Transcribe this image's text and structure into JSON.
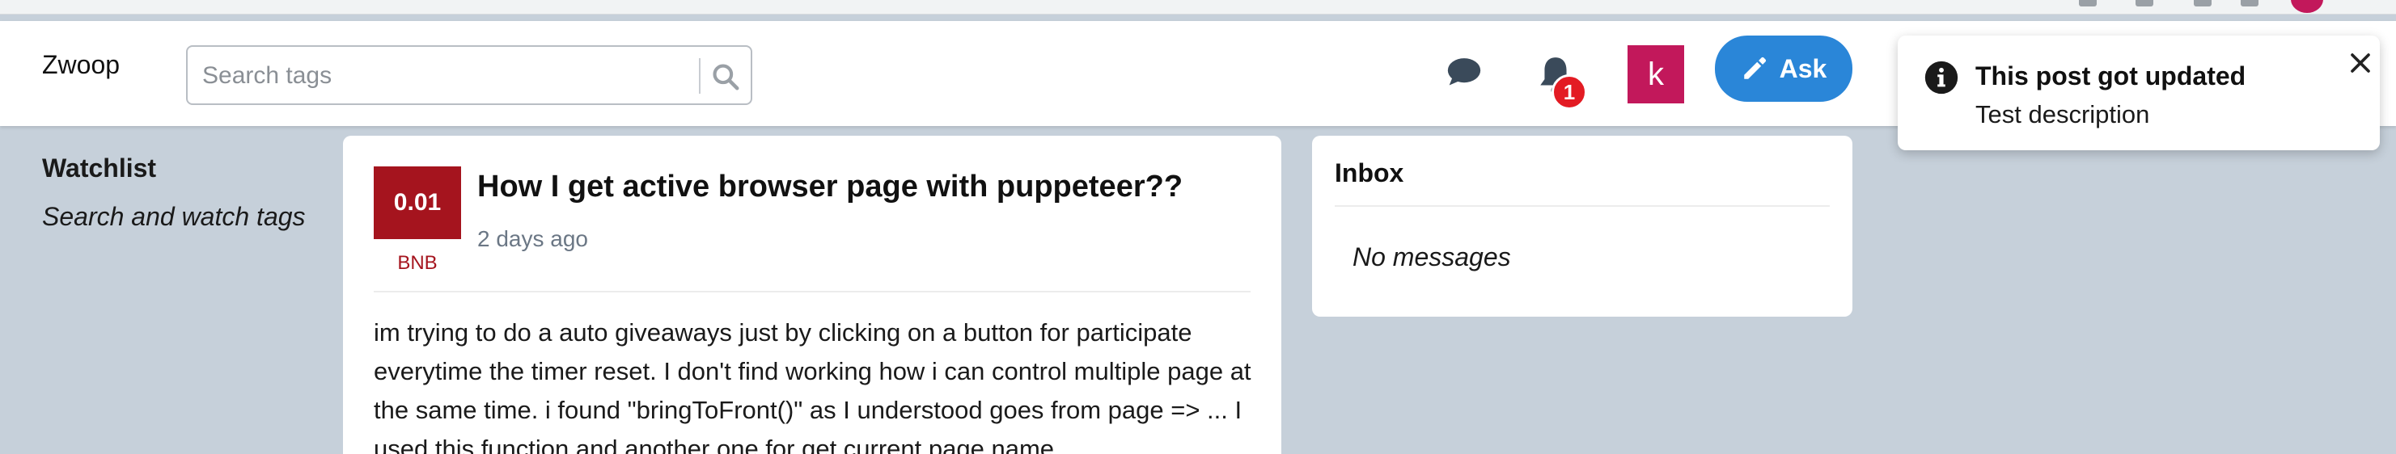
{
  "brand": {
    "name": "Zwoop"
  },
  "search": {
    "placeholder": "Search tags",
    "icon": "search-icon"
  },
  "header": {
    "chat_icon": "chat-bubble-icon",
    "notifications": {
      "icon": "bell-icon",
      "count": "1"
    },
    "avatar_letter": "k",
    "ask_button": {
      "label": "Ask",
      "icon": "pencil-icon"
    }
  },
  "toast": {
    "title": "This post got updated",
    "description": "Test description",
    "icon": "info-icon",
    "close_icon": "close-icon"
  },
  "watchlist": {
    "title": "Watchlist",
    "hint": "Search and watch tags"
  },
  "post": {
    "score": "0.01",
    "token": "BNB",
    "title": "How I get active browser page with puppeteer??",
    "time": "2 days ago",
    "body": "im trying to do a auto giveaways just by clicking on a button for participate everytime the timer reset. I don't find working how i can control multiple page at the same time. i found \"bringToFront()\" as I understood goes from page => ... I used this function and another one for get current page name"
  },
  "inbox": {
    "title": "Inbox",
    "empty_message": "No messages"
  },
  "colors": {
    "page_bg": "#c6d0da",
    "accent_blue": "#2a86d8",
    "score_red": "#a5141e",
    "avatar_pink": "#c2185b",
    "badge_red": "#e31b23"
  }
}
